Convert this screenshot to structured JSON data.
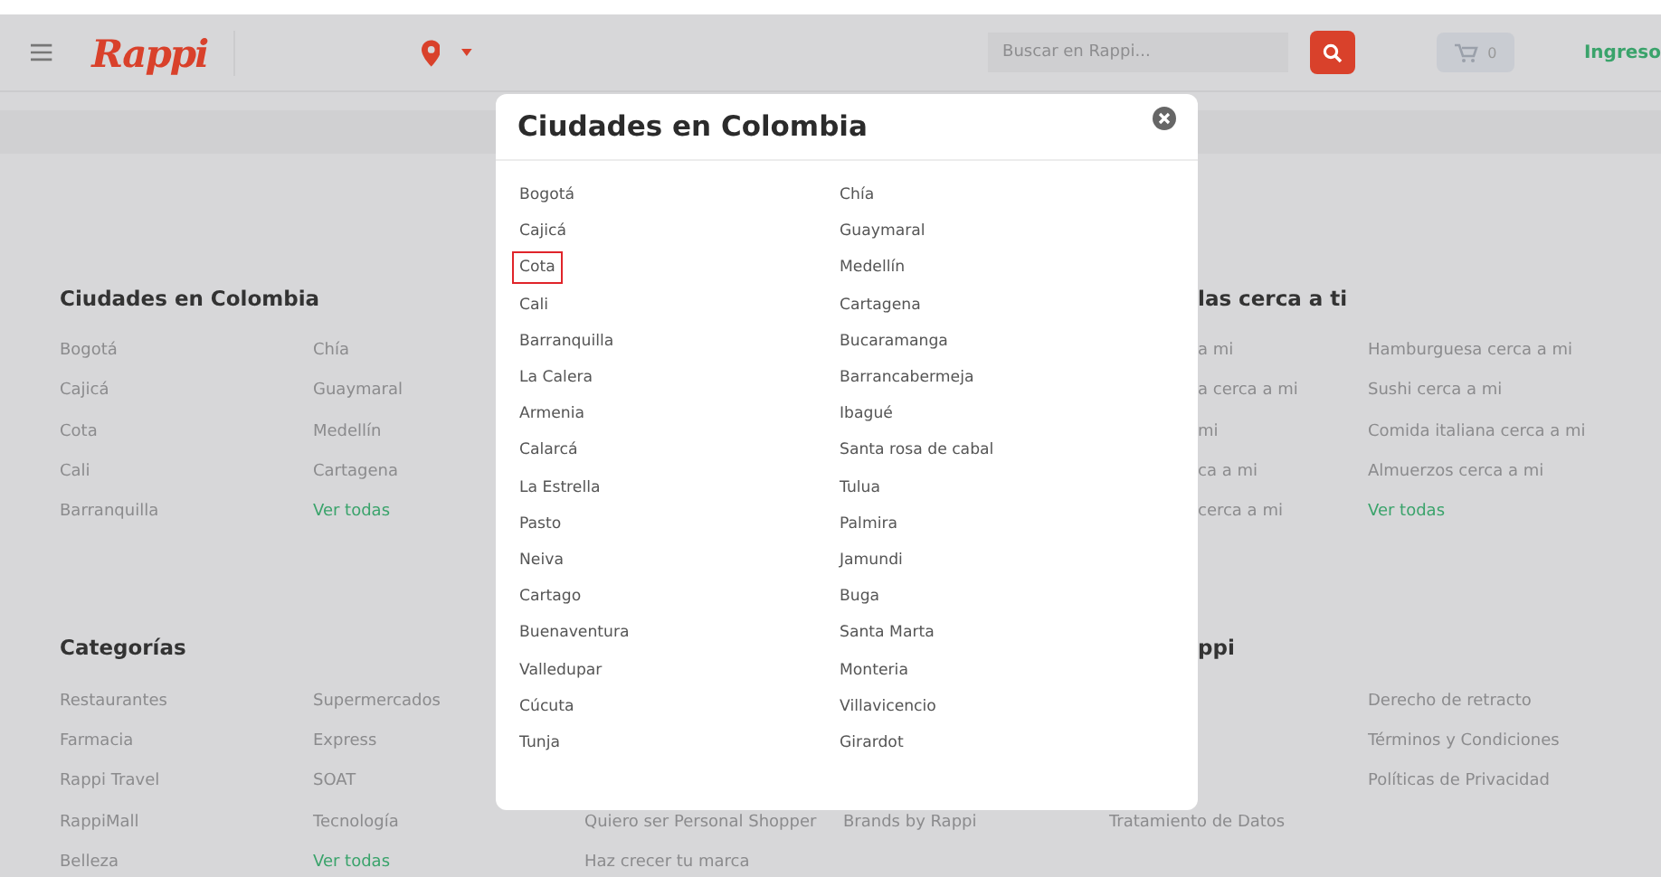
{
  "header": {
    "logo": "Rappi",
    "search": {
      "placeholder": "Buscar en Rappi..."
    },
    "cart_count": "0",
    "login": "Ingreso"
  },
  "footer_rows": [
    {
      "sections": [
        {
          "heading": "Ciudades en Colombia",
          "columns": [
            [
              {
                "text": "Bogotá",
                "kind": "link"
              },
              {
                "text": "Cajicá",
                "kind": "link"
              },
              {
                "text": "Cota",
                "kind": "link"
              },
              {
                "text": "Cali",
                "kind": "link"
              },
              {
                "text": "Barranquilla",
                "kind": "link"
              }
            ],
            [
              {
                "text": "Chía",
                "kind": "link"
              },
              {
                "text": "Guaymaral",
                "kind": "link"
              },
              {
                "text": "Medellín",
                "kind": "link"
              },
              {
                "text": "Cartagena",
                "kind": "link"
              },
              {
                "text": "Ver todas",
                "kind": "more"
              }
            ]
          ]
        },
        {
          "heading": "las cerca a ti",
          "columns": [
            [
              {
                "text": "a mi",
                "kind": "link"
              },
              {
                "text": "a cerca a mi",
                "kind": "link"
              },
              {
                "text": "mi",
                "kind": "link"
              },
              {
                "text": "ca a mi",
                "kind": "link"
              },
              {
                "text": "cerca a mi",
                "kind": "link"
              }
            ],
            [
              {
                "text": "Hamburguesa cerca a mi",
                "kind": "link"
              },
              {
                "text": "Sushi cerca a mi",
                "kind": "link"
              },
              {
                "text": "Comida italiana cerca a mi",
                "kind": "link"
              },
              {
                "text": "Almuerzos cerca a mi",
                "kind": "link"
              },
              {
                "text": "Ver todas",
                "kind": "more"
              }
            ]
          ]
        }
      ]
    },
    {
      "sections": [
        {
          "heading": "Categorías",
          "columns": [
            [
              {
                "text": "Restaurantes",
                "kind": "link"
              },
              {
                "text": "Farmacia",
                "kind": "link"
              },
              {
                "text": "Rappi Travel",
                "kind": "link"
              },
              {
                "text": "RappiMall",
                "kind": "link"
              },
              {
                "text": "Belleza",
                "kind": "link"
              }
            ],
            [
              {
                "text": "Supermercados",
                "kind": "link"
              },
              {
                "text": "Express",
                "kind": "link"
              },
              {
                "text": "SOAT",
                "kind": "link"
              },
              {
                "text": "Tecnología",
                "kind": "link"
              },
              {
                "text": "Ver todas",
                "kind": "more"
              }
            ]
          ]
        },
        {
          "heading": "ppi",
          "columns": [
            [
              {
                "text": "Quiero ser Personal Shopper",
                "kind": "link"
              },
              {
                "text": "Haz crecer tu marca",
                "kind": "link"
              }
            ],
            [
              {
                "text": "Brands by Rappi",
                "kind": "link"
              }
            ],
            [
              {
                "text": "Tratamiento de Datos",
                "kind": "link"
              }
            ],
            [
              {
                "text": "Derecho de retracto",
                "kind": "link"
              },
              {
                "text": "Términos y Condiciones",
                "kind": "link"
              },
              {
                "text": "Políticas de Privacidad",
                "kind": "link"
              }
            ]
          ]
        }
      ]
    }
  ],
  "modal": {
    "title": "Ciudades en Colombia",
    "columns": [
      [
        {
          "text": "Bogotá",
          "highlighted": false
        },
        {
          "text": "Cajicá",
          "highlighted": false
        },
        {
          "text": "Cota",
          "highlighted": true
        },
        {
          "text": "Cali",
          "highlighted": false
        },
        {
          "text": "Barranquilla",
          "highlighted": false
        },
        {
          "text": "La Calera",
          "highlighted": false
        },
        {
          "text": "Armenia",
          "highlighted": false
        },
        {
          "text": "Calarcá",
          "highlighted": false
        },
        {
          "text": "La Estrella",
          "highlighted": false
        },
        {
          "text": "Pasto",
          "highlighted": false
        },
        {
          "text": "Neiva",
          "highlighted": false
        },
        {
          "text": "Cartago",
          "highlighted": false
        },
        {
          "text": "Buenaventura",
          "highlighted": false
        },
        {
          "text": "Valledupar",
          "highlighted": false
        },
        {
          "text": "Cúcuta",
          "highlighted": false
        },
        {
          "text": "Tunja",
          "highlighted": false
        }
      ],
      [
        {
          "text": "Chía",
          "highlighted": false
        },
        {
          "text": "Guaymaral",
          "highlighted": false
        },
        {
          "text": "Medellín",
          "highlighted": false
        },
        {
          "text": "Cartagena",
          "highlighted": false
        },
        {
          "text": "Bucaramanga",
          "highlighted": false
        },
        {
          "text": "Barrancabermeja",
          "highlighted": false
        },
        {
          "text": "Ibagué",
          "highlighted": false
        },
        {
          "text": "Santa rosa de cabal",
          "highlighted": false
        },
        {
          "text": "Tulua",
          "highlighted": false
        },
        {
          "text": "Palmira",
          "highlighted": false
        },
        {
          "text": "Jamundi",
          "highlighted": false
        },
        {
          "text": "Buga",
          "highlighted": false
        },
        {
          "text": "Santa Marta",
          "highlighted": false
        },
        {
          "text": "Monteria",
          "highlighted": false
        },
        {
          "text": "Villavicencio",
          "highlighted": false
        },
        {
          "text": "Girardot",
          "highlighted": false
        }
      ]
    ]
  }
}
